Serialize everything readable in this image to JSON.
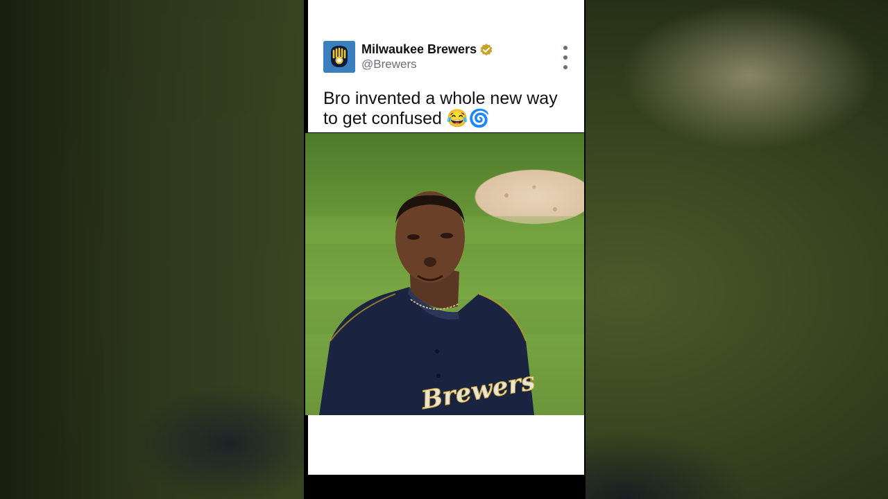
{
  "post": {
    "display_name": "Milwaukee Brewers",
    "handle": "@Brewers",
    "verified": true,
    "text": "Bro invented a whole new way to get confused 😂🌀",
    "avatar_icon": "brewers-ball-glove-logo",
    "more_icon": "vertical-dots-icon"
  },
  "video": {
    "jersey_text": "Brewers"
  },
  "colors": {
    "avatar_bg": "#3c7fbf",
    "verified_badge": "#c9a227",
    "handle_gray": "#6b6f75",
    "jersey_navy": "#1a2340"
  }
}
